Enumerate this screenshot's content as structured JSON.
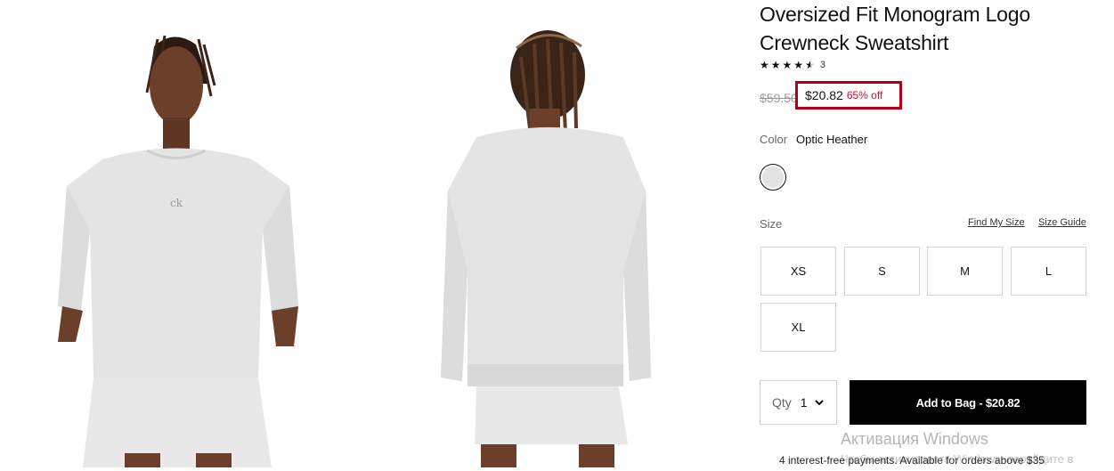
{
  "product": {
    "title": "Oversized Fit Monogram Logo Crewneck Sweatshirt",
    "rating_stars": 4.5,
    "rating_count": "3",
    "old_price": "$59.50",
    "sale_price": "$20.82",
    "discount": "65% off"
  },
  "color": {
    "label": "Color",
    "value": "Optic Heather",
    "swatch_color": "#e3e3e3"
  },
  "size": {
    "label": "Size",
    "find_my_size": "Find My Size",
    "size_guide": "Size Guide",
    "options": [
      "XS",
      "S",
      "M",
      "L",
      "XL"
    ]
  },
  "quantity": {
    "label": "Qty",
    "value": "1"
  },
  "cart": {
    "add_to_bag": "Add to Bag - $20.82"
  },
  "payment_note": "4 interest-free payments. Available for orders above $35",
  "windows_watermark": {
    "line1": "Активация Windows",
    "line2": "Чтобы активировать Windows, перейдите в"
  },
  "colors": {
    "price_highlight_border": "#b30015",
    "discount_text": "#c8102e",
    "button_bg": "#000000"
  }
}
